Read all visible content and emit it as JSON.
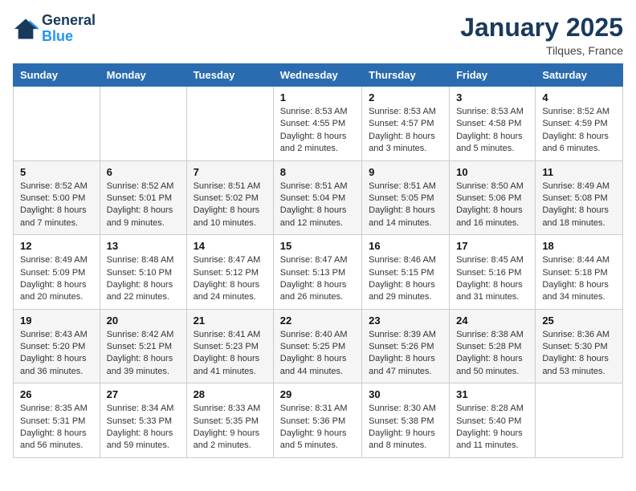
{
  "logo": {
    "line1": "General",
    "line2": "Blue"
  },
  "title": "January 2025",
  "location": "Tilques, France",
  "headers": [
    "Sunday",
    "Monday",
    "Tuesday",
    "Wednesday",
    "Thursday",
    "Friday",
    "Saturday"
  ],
  "weeks": [
    [
      {
        "day": "",
        "info": ""
      },
      {
        "day": "",
        "info": ""
      },
      {
        "day": "",
        "info": ""
      },
      {
        "day": "1",
        "info": "Sunrise: 8:53 AM\nSunset: 4:55 PM\nDaylight: 8 hours\nand 2 minutes."
      },
      {
        "day": "2",
        "info": "Sunrise: 8:53 AM\nSunset: 4:57 PM\nDaylight: 8 hours\nand 3 minutes."
      },
      {
        "day": "3",
        "info": "Sunrise: 8:53 AM\nSunset: 4:58 PM\nDaylight: 8 hours\nand 5 minutes."
      },
      {
        "day": "4",
        "info": "Sunrise: 8:52 AM\nSunset: 4:59 PM\nDaylight: 8 hours\nand 6 minutes."
      }
    ],
    [
      {
        "day": "5",
        "info": "Sunrise: 8:52 AM\nSunset: 5:00 PM\nDaylight: 8 hours\nand 7 minutes."
      },
      {
        "day": "6",
        "info": "Sunrise: 8:52 AM\nSunset: 5:01 PM\nDaylight: 8 hours\nand 9 minutes."
      },
      {
        "day": "7",
        "info": "Sunrise: 8:51 AM\nSunset: 5:02 PM\nDaylight: 8 hours\nand 10 minutes."
      },
      {
        "day": "8",
        "info": "Sunrise: 8:51 AM\nSunset: 5:04 PM\nDaylight: 8 hours\nand 12 minutes."
      },
      {
        "day": "9",
        "info": "Sunrise: 8:51 AM\nSunset: 5:05 PM\nDaylight: 8 hours\nand 14 minutes."
      },
      {
        "day": "10",
        "info": "Sunrise: 8:50 AM\nSunset: 5:06 PM\nDaylight: 8 hours\nand 16 minutes."
      },
      {
        "day": "11",
        "info": "Sunrise: 8:49 AM\nSunset: 5:08 PM\nDaylight: 8 hours\nand 18 minutes."
      }
    ],
    [
      {
        "day": "12",
        "info": "Sunrise: 8:49 AM\nSunset: 5:09 PM\nDaylight: 8 hours\nand 20 minutes."
      },
      {
        "day": "13",
        "info": "Sunrise: 8:48 AM\nSunset: 5:10 PM\nDaylight: 8 hours\nand 22 minutes."
      },
      {
        "day": "14",
        "info": "Sunrise: 8:47 AM\nSunset: 5:12 PM\nDaylight: 8 hours\nand 24 minutes."
      },
      {
        "day": "15",
        "info": "Sunrise: 8:47 AM\nSunset: 5:13 PM\nDaylight: 8 hours\nand 26 minutes."
      },
      {
        "day": "16",
        "info": "Sunrise: 8:46 AM\nSunset: 5:15 PM\nDaylight: 8 hours\nand 29 minutes."
      },
      {
        "day": "17",
        "info": "Sunrise: 8:45 AM\nSunset: 5:16 PM\nDaylight: 8 hours\nand 31 minutes."
      },
      {
        "day": "18",
        "info": "Sunrise: 8:44 AM\nSunset: 5:18 PM\nDaylight: 8 hours\nand 34 minutes."
      }
    ],
    [
      {
        "day": "19",
        "info": "Sunrise: 8:43 AM\nSunset: 5:20 PM\nDaylight: 8 hours\nand 36 minutes."
      },
      {
        "day": "20",
        "info": "Sunrise: 8:42 AM\nSunset: 5:21 PM\nDaylight: 8 hours\nand 39 minutes."
      },
      {
        "day": "21",
        "info": "Sunrise: 8:41 AM\nSunset: 5:23 PM\nDaylight: 8 hours\nand 41 minutes."
      },
      {
        "day": "22",
        "info": "Sunrise: 8:40 AM\nSunset: 5:25 PM\nDaylight: 8 hours\nand 44 minutes."
      },
      {
        "day": "23",
        "info": "Sunrise: 8:39 AM\nSunset: 5:26 PM\nDaylight: 8 hours\nand 47 minutes."
      },
      {
        "day": "24",
        "info": "Sunrise: 8:38 AM\nSunset: 5:28 PM\nDaylight: 8 hours\nand 50 minutes."
      },
      {
        "day": "25",
        "info": "Sunrise: 8:36 AM\nSunset: 5:30 PM\nDaylight: 8 hours\nand 53 minutes."
      }
    ],
    [
      {
        "day": "26",
        "info": "Sunrise: 8:35 AM\nSunset: 5:31 PM\nDaylight: 8 hours\nand 56 minutes."
      },
      {
        "day": "27",
        "info": "Sunrise: 8:34 AM\nSunset: 5:33 PM\nDaylight: 8 hours\nand 59 minutes."
      },
      {
        "day": "28",
        "info": "Sunrise: 8:33 AM\nSunset: 5:35 PM\nDaylight: 9 hours\nand 2 minutes."
      },
      {
        "day": "29",
        "info": "Sunrise: 8:31 AM\nSunset: 5:36 PM\nDaylight: 9 hours\nand 5 minutes."
      },
      {
        "day": "30",
        "info": "Sunrise: 8:30 AM\nSunset: 5:38 PM\nDaylight: 9 hours\nand 8 minutes."
      },
      {
        "day": "31",
        "info": "Sunrise: 8:28 AM\nSunset: 5:40 PM\nDaylight: 9 hours\nand 11 minutes."
      },
      {
        "day": "",
        "info": ""
      }
    ]
  ]
}
